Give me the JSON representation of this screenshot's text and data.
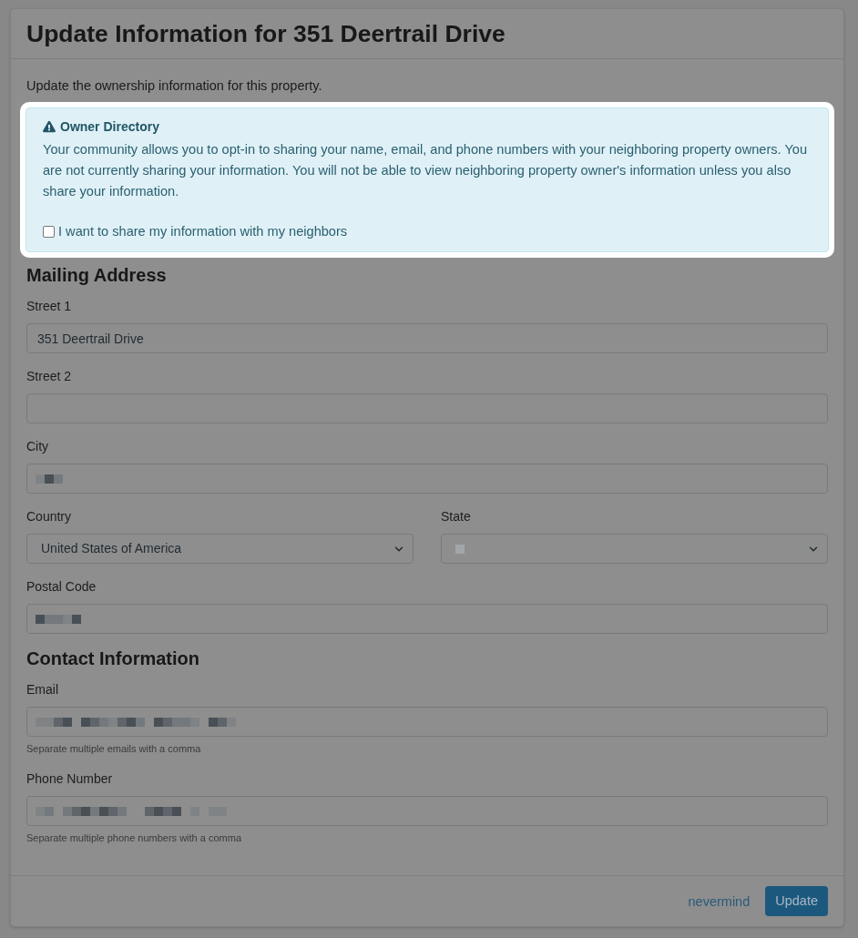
{
  "modal": {
    "title": "Update Information for 351 Deertrail Drive",
    "intro": "Update the ownership information for this property."
  },
  "owner_directory_alert": {
    "highlighted": true,
    "title": "Owner Directory",
    "message": "Your community allows you to opt-in to sharing your name, email, and phone numbers with your neighboring property owners. You are not currently sharing your information. You will not be able to view neighboring property owner's information unless you also share your information.",
    "checkbox": {
      "label": "I want to share my information with my neighbors",
      "checked": false
    }
  },
  "sections": [
    {
      "heading": "Mailing Address",
      "fields": [
        {
          "kind": "input",
          "label": "Street 1",
          "value": "351 Deertrail Drive",
          "redacted": false
        },
        {
          "kind": "input",
          "label": "Street 2"
        },
        {
          "kind": "input",
          "label": "City",
          "redacted": true
        },
        {
          "kind": "row",
          "fields": [
            {
              "kind": "select",
              "label": "Country",
              "value": "United States of America",
              "redacted": false
            },
            {
              "kind": "select",
              "label": "State",
              "redacted": true
            }
          ]
        },
        {
          "kind": "input",
          "label": "Postal Code",
          "redacted": true
        }
      ]
    },
    {
      "heading": "Contact Information",
      "fields": [
        {
          "kind": "input",
          "label": "Email",
          "redacted": true,
          "help": "Separate multiple emails with a comma"
        },
        {
          "kind": "input",
          "label": "Phone Number",
          "redacted": true,
          "help": "Separate multiple phone numbers with a comma"
        }
      ]
    }
  ],
  "footer": {
    "buttons": [
      {
        "kind": "link",
        "label": "nevermind"
      },
      {
        "kind": "primary",
        "label": "Update"
      }
    ]
  }
}
